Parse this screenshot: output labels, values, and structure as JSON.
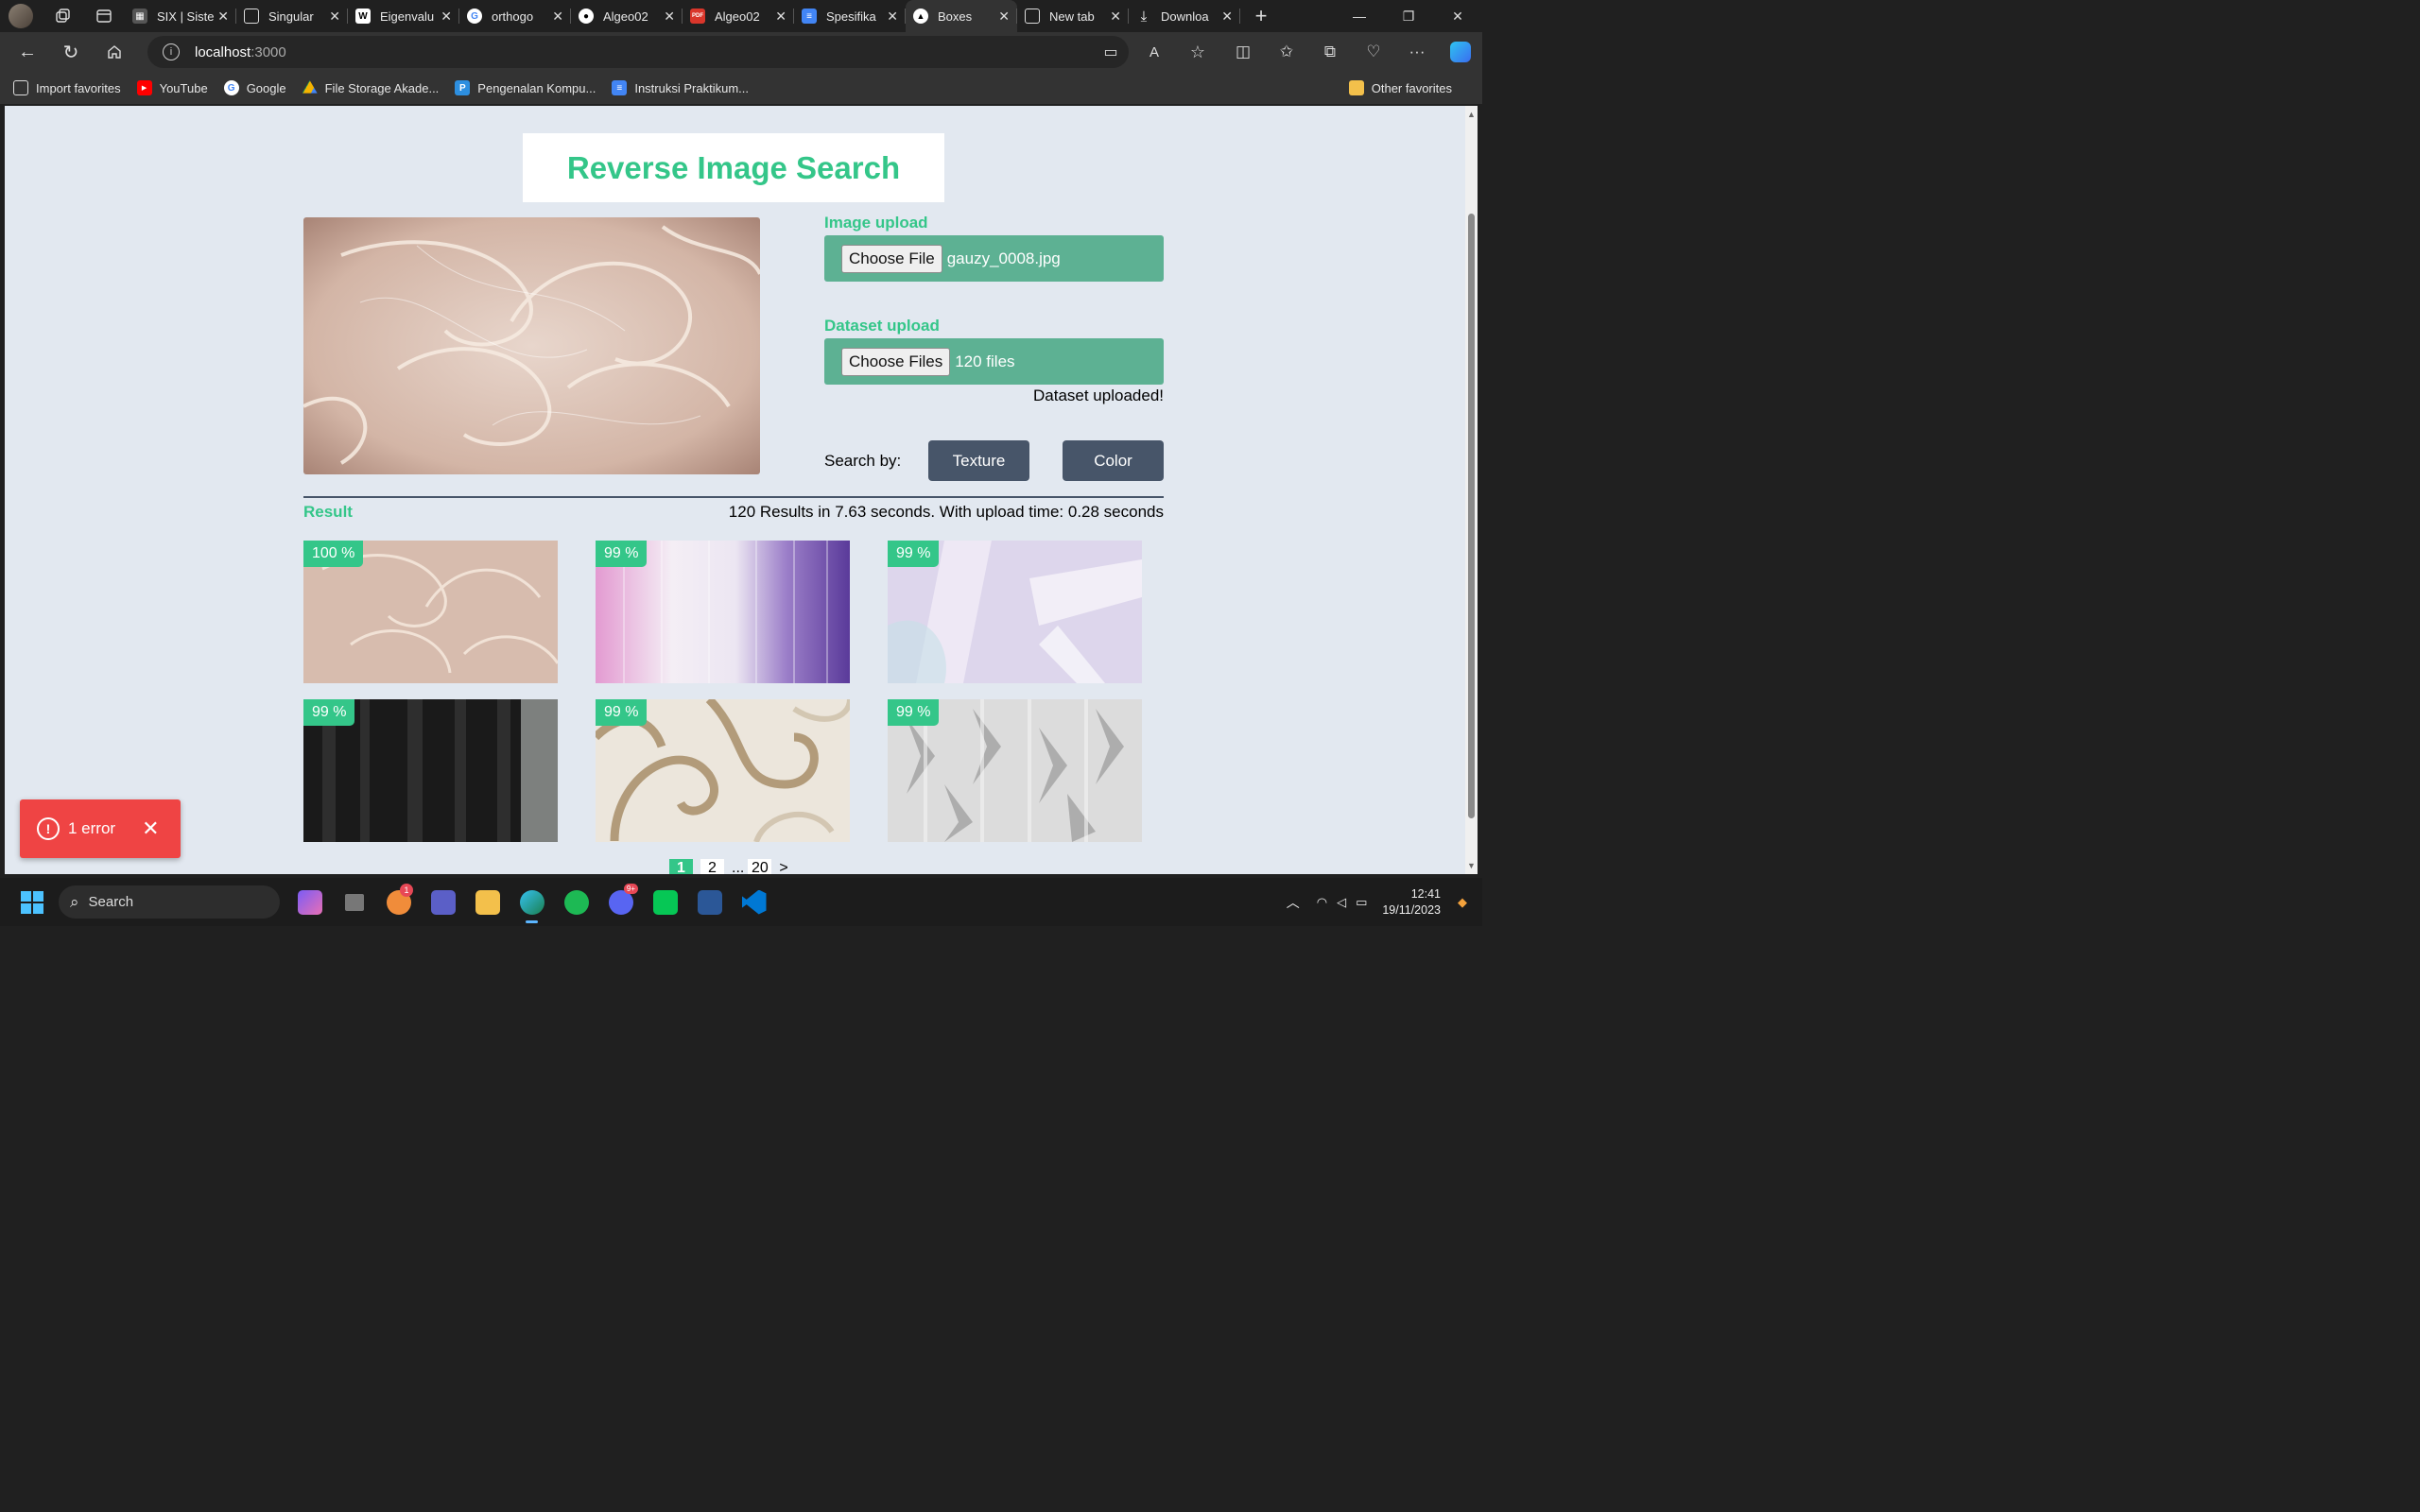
{
  "browser": {
    "tabs": [
      {
        "label": "",
        "icon": "profile-avatar"
      },
      {
        "label": "",
        "icon": "workspaces-icon"
      },
      {
        "label": "",
        "icon": "tab-actions-icon"
      },
      {
        "label": "SIX | Siste",
        "icon": "six-icon"
      },
      {
        "label": "Singular",
        "icon": "page-icon"
      },
      {
        "label": "Eigenvalu",
        "icon": "wikipedia-icon"
      },
      {
        "label": "orthogo",
        "icon": "google-icon"
      },
      {
        "label": "Algeo02",
        "icon": "github-icon"
      },
      {
        "label": "Algeo02",
        "icon": "pdf-icon"
      },
      {
        "label": "Spesifika",
        "icon": "docs-icon"
      },
      {
        "label": "Boxes",
        "icon": "vercel-icon"
      },
      {
        "label": "New tab",
        "icon": "newtab-icon"
      },
      {
        "label": "Downloa",
        "icon": "download-icon"
      }
    ],
    "url_host": "localhost",
    "url_port": ":3000",
    "bookmarks": [
      {
        "label": "Import favorites"
      },
      {
        "label": "YouTube"
      },
      {
        "label": "Google"
      },
      {
        "label": "File Storage Akade..."
      },
      {
        "label": "Pengenalan Kompu..."
      },
      {
        "label": "Instruksi Praktikum..."
      }
    ],
    "other_favorites": "Other favorites"
  },
  "app": {
    "title": "Reverse Image Search",
    "image_upload": {
      "label": "Image upload",
      "button": "Choose File",
      "filename": "gauzy_0008.jpg"
    },
    "dataset_upload": {
      "label": "Dataset upload",
      "button": "Choose Files",
      "count": "120 files",
      "status": "Dataset uploaded!"
    },
    "search_by": {
      "label": "Search by:",
      "texture": "Texture",
      "color": "Color"
    },
    "result": {
      "label": "Result",
      "meta": "120 Results in 7.63 seconds. With upload time: 0.28 seconds",
      "items": [
        {
          "score": "100 %",
          "image": "peach-tulle"
        },
        {
          "score": "99 %",
          "image": "pink-purple-curtains"
        },
        {
          "score": "99 %",
          "image": "lavender-satin-sheer"
        },
        {
          "score": "99 %",
          "image": "black-curtain"
        },
        {
          "score": "99 %",
          "image": "swirl-gold-sheer"
        },
        {
          "score": "99 %",
          "image": "grey-pattern-sheer"
        }
      ]
    },
    "pagination": {
      "pages": [
        "1",
        "2"
      ],
      "ellipsis": "...",
      "last": "20",
      "next": ">"
    }
  },
  "error_toast": {
    "label": "1 error"
  },
  "taskbar": {
    "search": "Search",
    "time": "12:41",
    "date": "19/11/2023",
    "teams_badge": "1",
    "discord_badge": "9+"
  },
  "colors": {
    "accent_green": "#34c689",
    "upload_box": "#5db193",
    "button_slate": "#475569",
    "page_bg": "#e2e8f0",
    "error_red": "#ef4444"
  }
}
